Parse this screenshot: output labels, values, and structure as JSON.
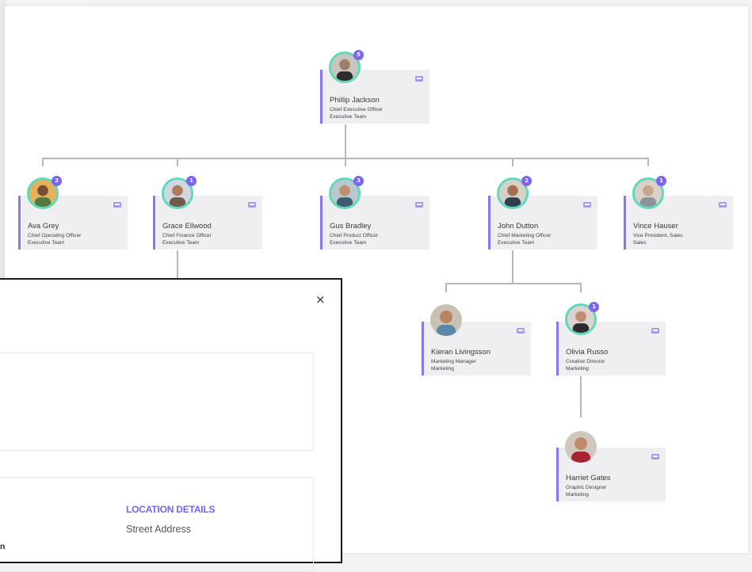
{
  "org_chart": {
    "ceo": {
      "name": "Phillip Jackson",
      "title": "Chief Executive Officer",
      "dept": "Executive Team",
      "badge": "5"
    },
    "level1": [
      {
        "name": "Ava Grey",
        "title": "Chief Operating Officer",
        "dept": "Executive Team",
        "badge": "2"
      },
      {
        "name": "Grace Ellwood",
        "title": "Chief Finance Officer",
        "dept": "Executive Team",
        "badge": "1"
      },
      {
        "name": "Gus Bradley",
        "title": "Chief Product Officer",
        "dept": "Executive Team",
        "badge": "3"
      },
      {
        "name": "John Dutton",
        "title": "Chief Marketing Officer",
        "dept": "Executive Team",
        "badge": "2"
      },
      {
        "name": "Vince Hauser",
        "title": "Vice President, Sales",
        "dept": "Sales",
        "badge": "1"
      }
    ],
    "level2": [
      {
        "name": "Kieran Livingsson",
        "title": "Marketing Manager",
        "dept": "Marketing"
      },
      {
        "name": "Olivia Russo",
        "title": "Creative Director",
        "dept": "Marketing",
        "badge": "1"
      }
    ],
    "level3": [
      {
        "name": "Harriet Gates",
        "title": "Graphic Designer",
        "dept": "Marketing"
      }
    ]
  },
  "modal": {
    "close_label": "×",
    "location_heading": "LOCATION DETAILS",
    "street_label": "Street Address",
    "cut_text": "n"
  },
  "colors": {
    "accent": "#8d74f0",
    "avatar_ring": "#5fd9b9",
    "badge": "#7d63f2",
    "line": "#b7b7b7"
  }
}
